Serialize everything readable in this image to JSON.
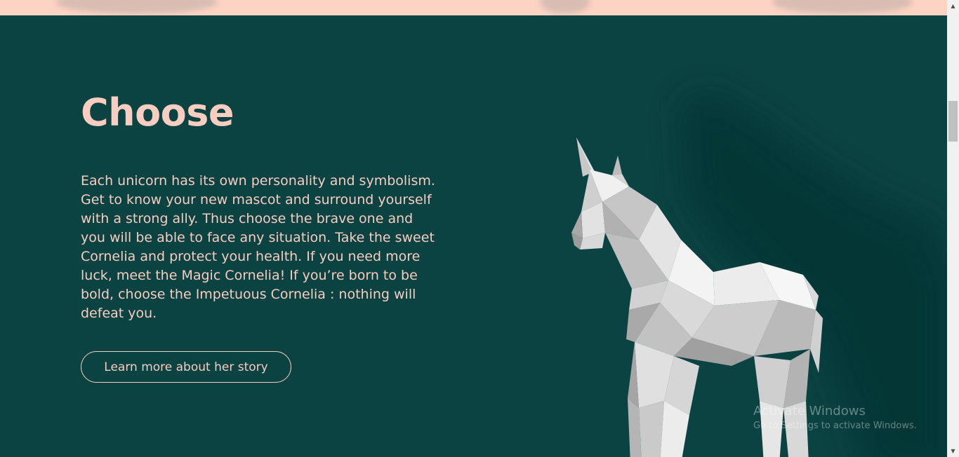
{
  "section": {
    "title": "Choose",
    "description": "Each unicorn has its own personality and symbolism. Get to know your new mascot and surround yourself with a strong ally. Thus choose the brave one and you will be able to face any situation. Take the sweet Cornelia and protect your health. If you need more luck, meet the Magic Cornelia! If you’re born to be bold, choose the Impetuous Cornelia : nothing will defeat you.",
    "button_label": "Learn more about her story",
    "image_alt": "low-poly-unicorn"
  },
  "watermark": {
    "title": "Activate Windows",
    "subtitle": "Go to Settings to activate Windows."
  },
  "colors": {
    "section_bg": "#0b4242",
    "accent_text": "#f9cdbf",
    "top_band": "#fdd3c4"
  },
  "icons": {
    "scroll_up": "scroll-up-arrow-icon",
    "scroll_down": "scroll-down-arrow-icon"
  },
  "scroll": {
    "arrow_up": "▲",
    "arrow_down": "▼"
  }
}
